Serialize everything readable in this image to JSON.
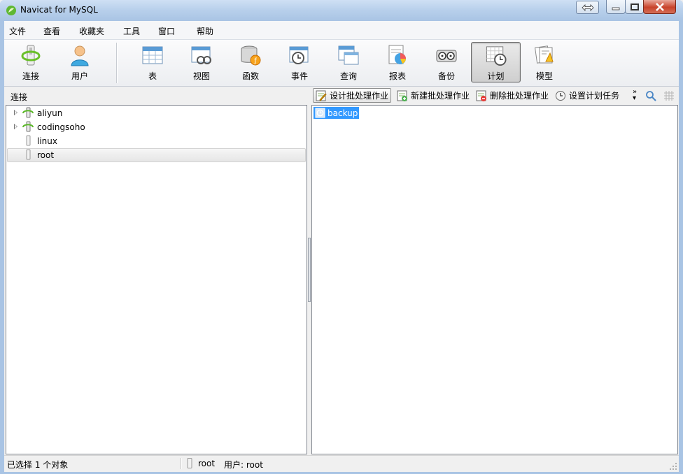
{
  "window": {
    "title": "Navicat for MySQL"
  },
  "menu": [
    "文件",
    "查看",
    "收藏夹",
    "工具",
    "窗口",
    "帮助"
  ],
  "toolbar": {
    "items": [
      {
        "label": "连接",
        "icon": "connection-icon"
      },
      {
        "label": "用户",
        "icon": "user-icon"
      },
      {
        "label": "表",
        "icon": "table-icon"
      },
      {
        "label": "视图",
        "icon": "view-icon"
      },
      {
        "label": "函数",
        "icon": "function-icon"
      },
      {
        "label": "事件",
        "icon": "event-icon"
      },
      {
        "label": "查询",
        "icon": "query-icon"
      },
      {
        "label": "报表",
        "icon": "report-icon"
      },
      {
        "label": "备份",
        "icon": "backup-icon"
      },
      {
        "label": "计划",
        "icon": "schedule-icon",
        "active": true
      },
      {
        "label": "模型",
        "icon": "model-icon"
      }
    ]
  },
  "connections": {
    "header": "连接",
    "items": [
      {
        "name": "aliyun",
        "expandable": true,
        "open": true
      },
      {
        "name": "codingsoho",
        "expandable": true,
        "open": true
      },
      {
        "name": "linux",
        "expandable": false,
        "open": false
      },
      {
        "name": "root",
        "expandable": false,
        "open": false,
        "selected": true
      }
    ]
  },
  "object_toolbar": {
    "design": "设计批处理作业",
    "new": "新建批处理作业",
    "delete": "删除批处理作业",
    "set_schedule": "设置计划任务",
    "more": "»"
  },
  "objects": [
    {
      "name": "backup",
      "selected": true
    }
  ],
  "status": {
    "selection": "已选择 1 个对象",
    "connection": "root",
    "user": "用户: root"
  }
}
